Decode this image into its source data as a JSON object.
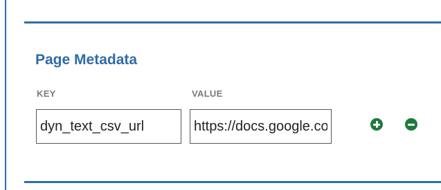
{
  "section": {
    "title": "Page Metadata"
  },
  "columns": {
    "key_label": "KEY",
    "value_label": "VALUE"
  },
  "row": {
    "key_value": "dyn_text_csv_url",
    "value_value": "https://docs.google.com/"
  },
  "icons": {
    "add": "plus-circle-icon",
    "remove": "minus-circle-icon"
  },
  "colors": {
    "accent": "#2e6da4",
    "icon_green": "#1e7a3a",
    "label_gray": "#7a7a7a"
  }
}
